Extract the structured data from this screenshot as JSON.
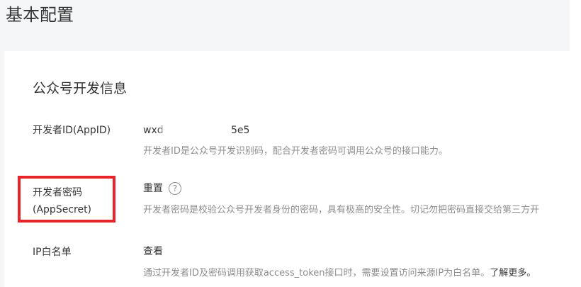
{
  "page": {
    "title": "基本配置"
  },
  "section": {
    "title": "公众号开发信息"
  },
  "rows": {
    "appid": {
      "label": "开发者ID(AppID)",
      "value_prefix": "wxd",
      "value_suffix": "5e5",
      "desc": "开发者ID是公众号开发识别码，配合开发者密码可调用公众号的接口能力。"
    },
    "secret": {
      "label_line1": "开发者密码",
      "label_line2": "(AppSecret)",
      "action": "重置",
      "help_icon": "?",
      "desc": "开发者密码是校验公众号开发者身份的密码，具有极高的安全性。切记勿把密码直接交给第三方开"
    },
    "ip": {
      "label": "IP白名单",
      "action": "查看",
      "desc": "通过开发者ID及密码调用获取access_token接口时，需要设置访问来源IP为白名单。",
      "learn_more": "了解更多。"
    }
  },
  "colors": {
    "highlight": "#e8232a",
    "muted_text": "#8d8d8d",
    "background": "#f5f6f7"
  },
  "icons": {
    "help": "question-circle-icon"
  }
}
